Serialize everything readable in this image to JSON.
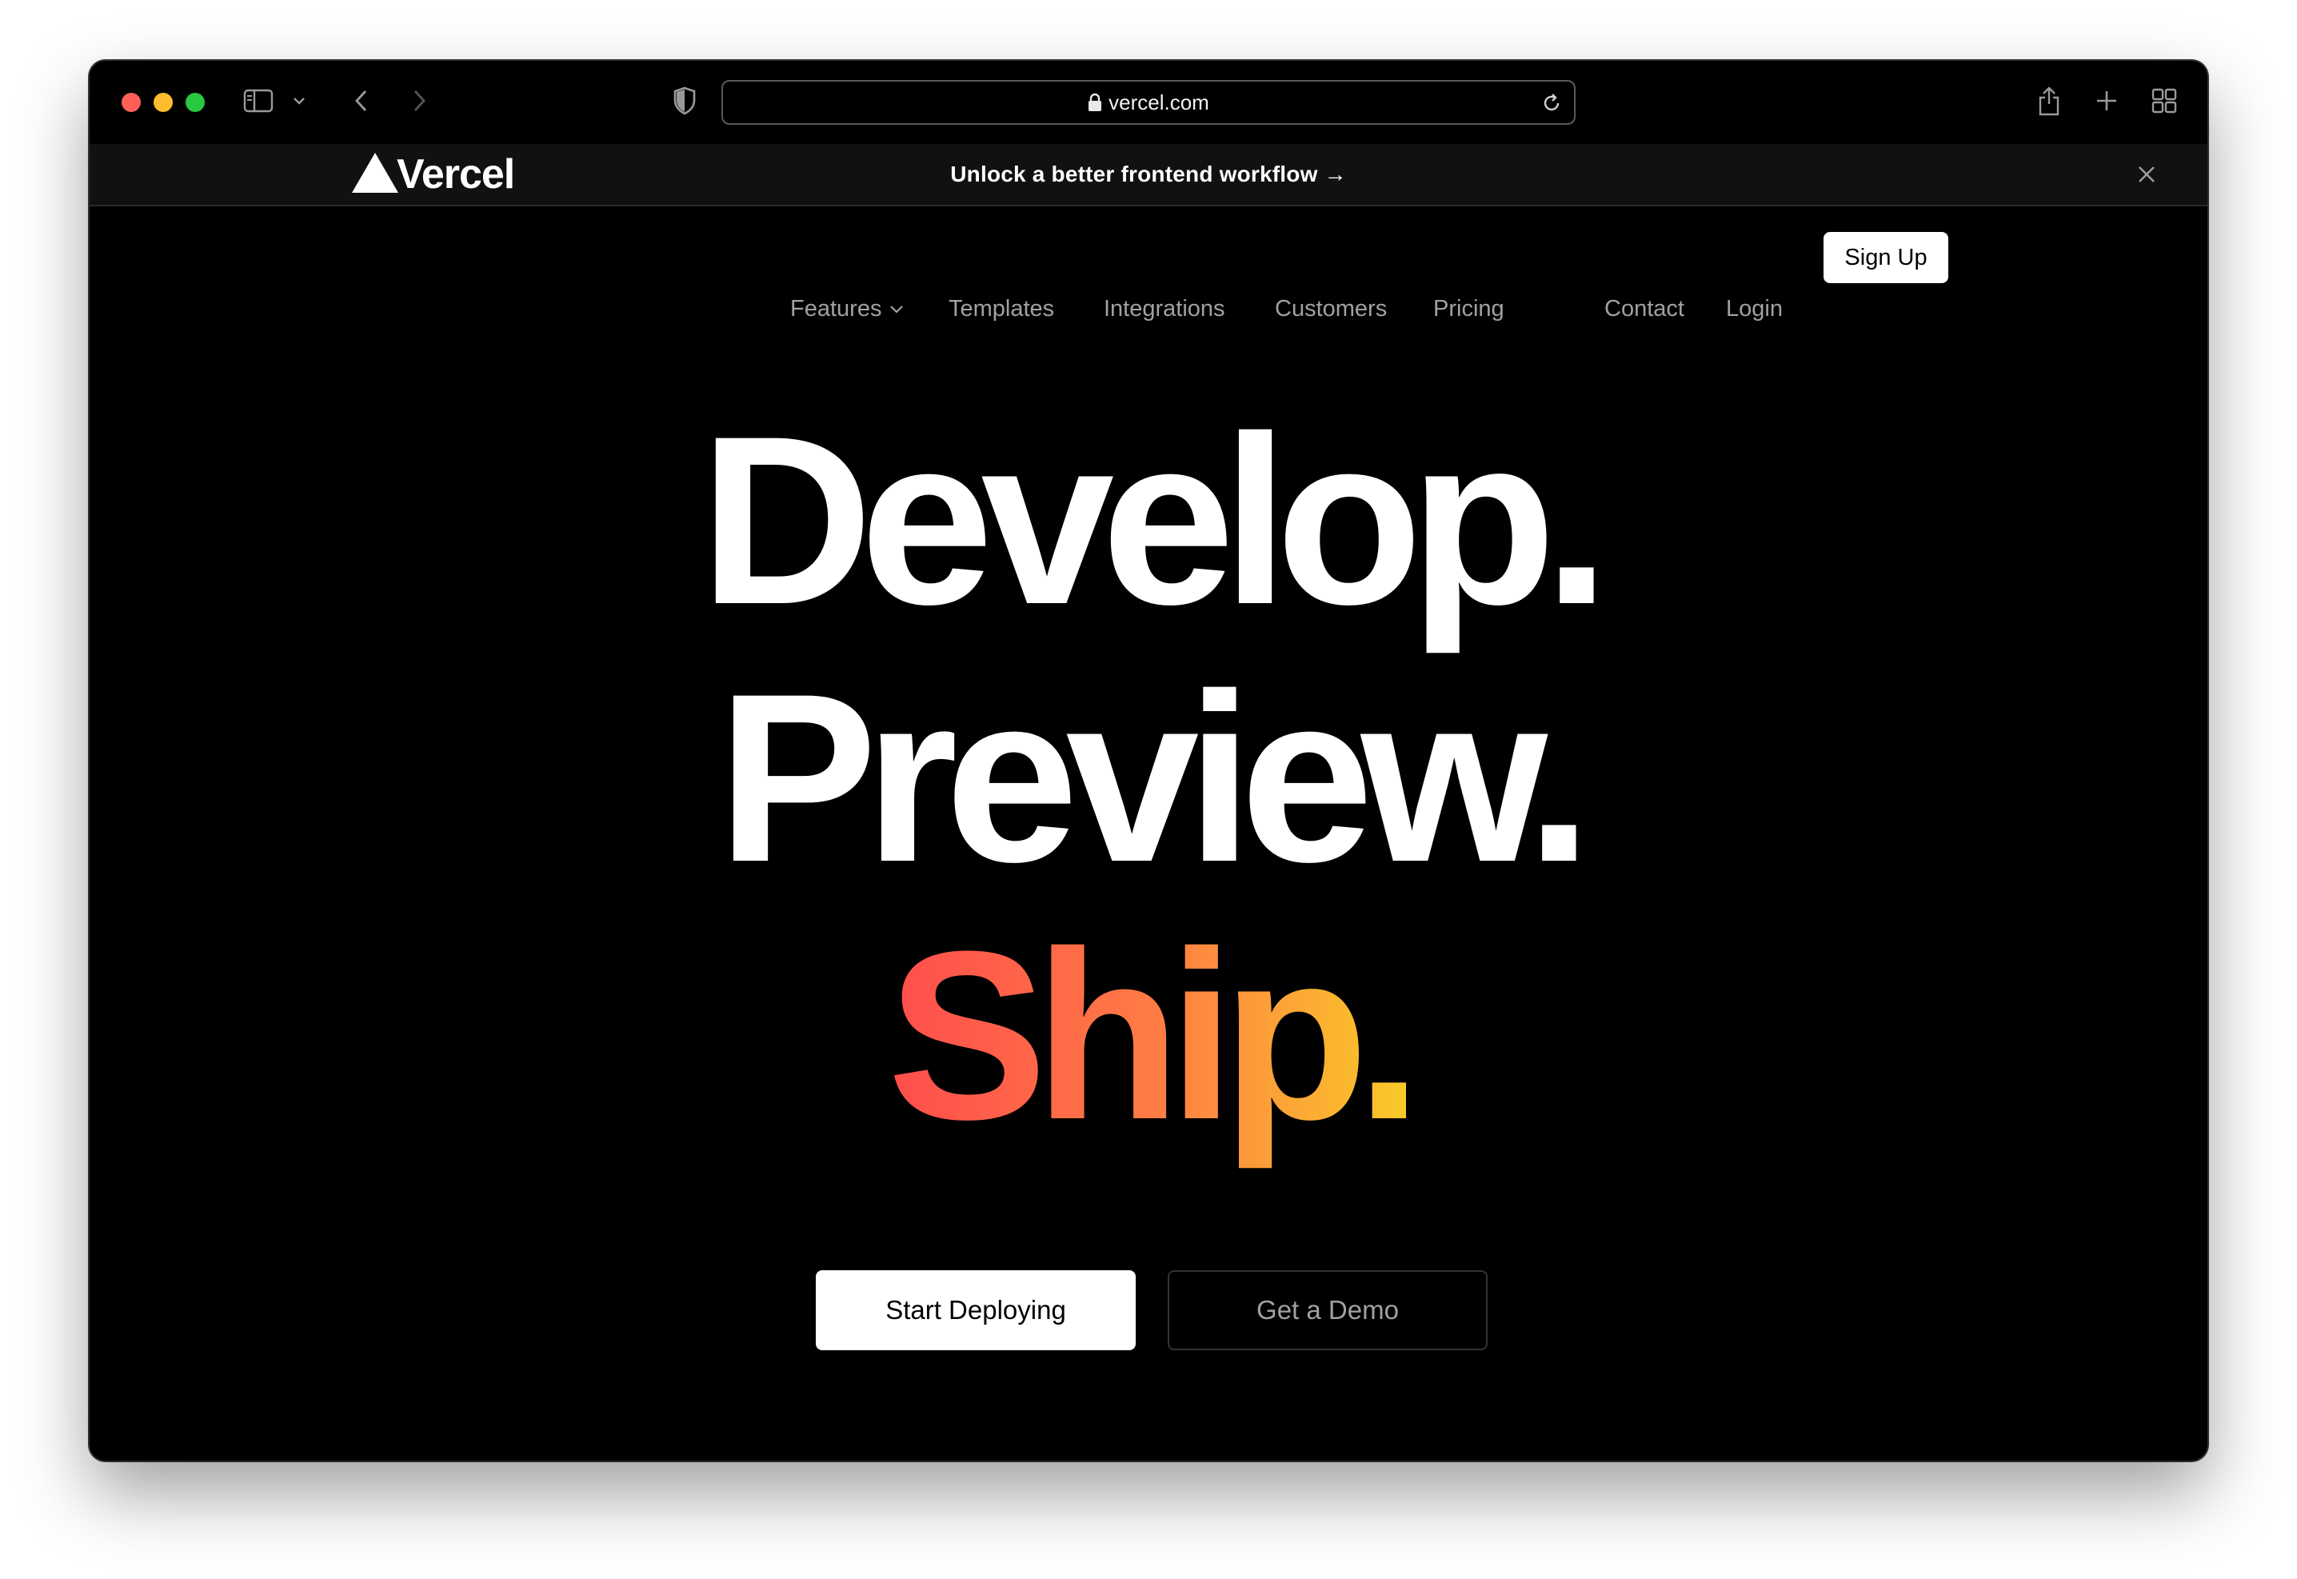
{
  "browser": {
    "url": "vercel.com",
    "icons": {
      "sidebar": "sidebar-icon",
      "sidebar_menu": "chevron-down-icon",
      "back": "chevron-left-icon",
      "forward": "chevron-right-icon",
      "privacy": "shield-icon",
      "lock": "lock-icon",
      "reload": "reload-icon",
      "share": "share-icon",
      "new_tab": "plus-icon",
      "tab_overview": "grid-icon"
    }
  },
  "banner": {
    "text": "Unlock a better frontend workflow →",
    "close_icon": "close-icon"
  },
  "nav": {
    "brand": "Vercel",
    "features": "Features",
    "templates": "Templates",
    "integrations": "Integrations",
    "customers": "Customers",
    "pricing": "Pricing",
    "contact": "Contact",
    "login": "Login",
    "signup": "Sign Up"
  },
  "hero": {
    "line1": "Develop.",
    "line2": "Preview.",
    "line3": "Ship.",
    "gradient_colors": [
      "#ff4d4d",
      "#ff7a45",
      "#f9cb28"
    ]
  },
  "cta": {
    "primary": "Start Deploying",
    "secondary": "Get a Demo"
  },
  "colors": {
    "background": "#000000",
    "text_primary": "#ffffff",
    "text_muted": "#a1a1a1"
  }
}
